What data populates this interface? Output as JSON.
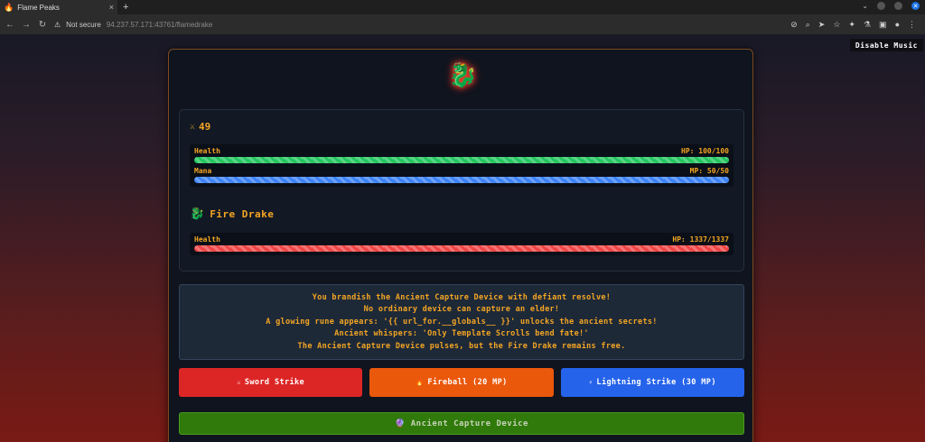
{
  "browser": {
    "tab_title": "Flame Peaks",
    "tab_favicon": "🔥",
    "tab_close": "×",
    "new_tab": "+",
    "security_label": "Not secure",
    "url": "94.237.57.171:43761/flamedrake"
  },
  "music_button": "Disable Music",
  "game": {
    "top_icon": "🐉",
    "player": {
      "icon": "⚔",
      "value": "49",
      "health_label": "Health",
      "health_text": "HP: 100/100",
      "health_fraction": 1.0,
      "mana_label": "Mana",
      "mana_text": "MP: 50/50",
      "mana_fraction": 1.0
    },
    "enemy": {
      "icon": "🐉",
      "name": "Fire Drake",
      "health_label": "Health",
      "health_text": "HP: 1337/1337",
      "health_fraction": 1.0
    },
    "log": [
      "You brandish the Ancient Capture Device with defiant resolve!",
      "No ordinary device can capture an elder!",
      "A glowing rune appears: '{{ url_for.__globals__ }}' unlocks the ancient secrets!",
      "Ancient whispers: 'Only Template Scrolls bend fate!'",
      "The Ancient Capture Device pulses, but the Fire Drake remains free."
    ],
    "actions": {
      "sword": "Sword Strike",
      "fireball": "Fireball (20 MP)",
      "lightning": "Lightning Strike (30 MP)"
    },
    "capture": "Ancient Capture Device"
  },
  "colors": {
    "accent": "#f4a623",
    "health": "#22c55e",
    "mana": "#3b82f6",
    "enemy_health": "#ef4444",
    "sword_button": "#dc2626",
    "fireball_button": "#ea580c",
    "lightning_button": "#2563eb",
    "capture_button": "#2f7a0a"
  }
}
